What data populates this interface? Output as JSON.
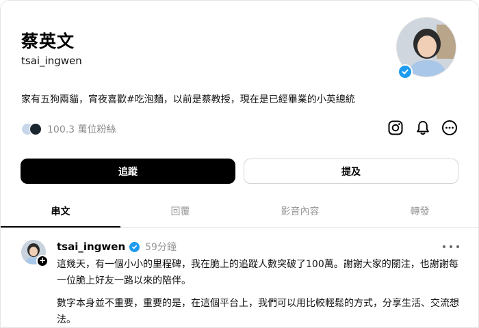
{
  "profile": {
    "display_name": "蔡英文",
    "username": "tsai_ingwen",
    "bio": "家有五狗兩貓，宵夜喜歡#吃泡麵，以前是蔡教授，現在是已經畢業的小英總統",
    "followers": "100.3 萬位粉絲",
    "verified_icon": "verified-badge-icon"
  },
  "actions": {
    "follow_label": "追蹤",
    "mention_label": "提及",
    "icons": [
      "instagram-icon",
      "bell-icon",
      "more-circle-icon"
    ]
  },
  "tabs": [
    {
      "label": "串文",
      "active": true
    },
    {
      "label": "回覆",
      "active": false
    },
    {
      "label": "影音內容",
      "active": false
    },
    {
      "label": "轉發",
      "active": false
    }
  ],
  "post": {
    "username": "tsai_ingwen",
    "time": "59分鐘",
    "paragraphs": [
      "這幾天，有一個小小的里程碑，我在脆上的追蹤人數突破了100萬。謝謝大家的關注，也謝謝每一位脆上好友一路以來的陪伴。",
      "數字本身並不重要，重要的是，在這個平台上，我們可以用比較輕鬆的方式，分享生活、交流想法。"
    ]
  },
  "colors": {
    "accent": "#1d9bf0",
    "primary_button": "#000000",
    "muted_text": "#999999"
  }
}
